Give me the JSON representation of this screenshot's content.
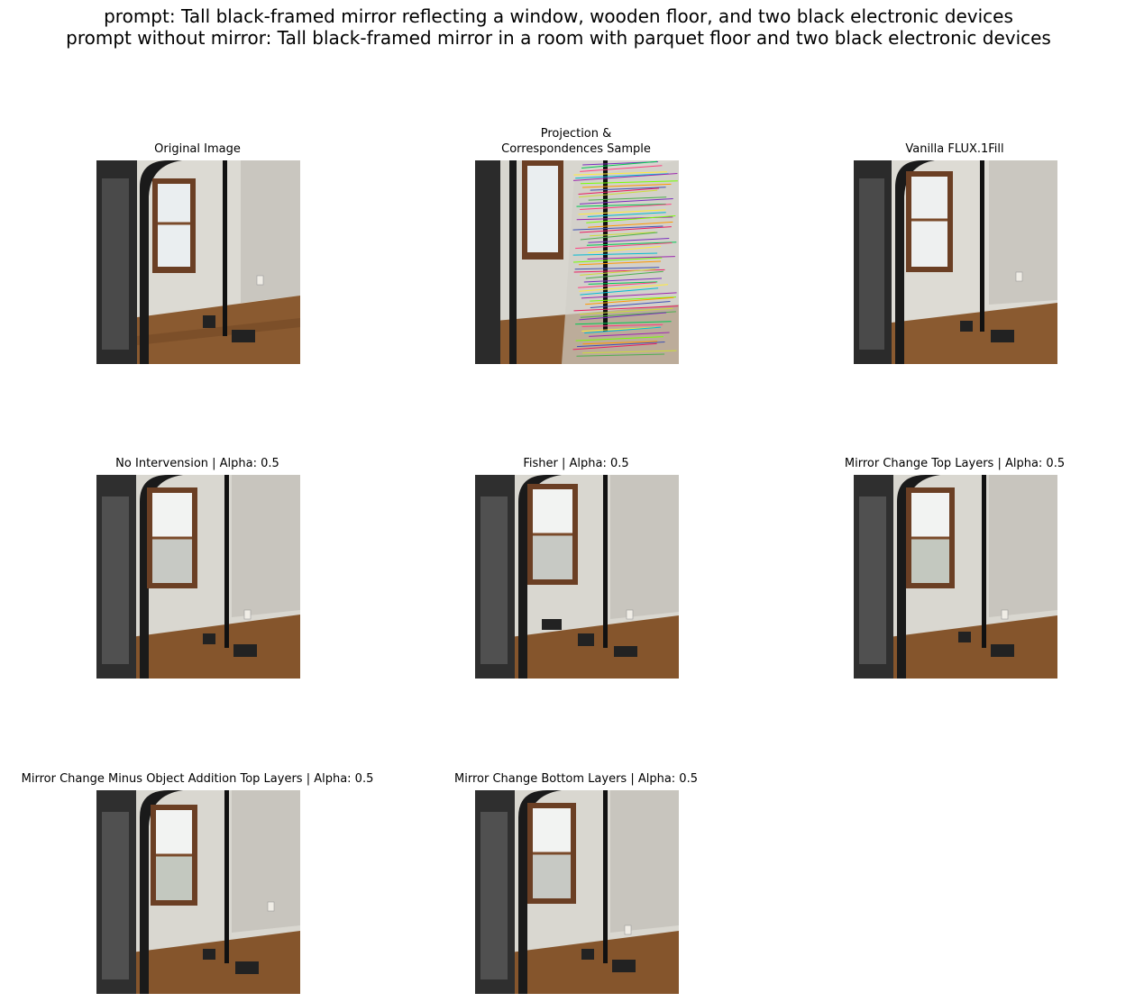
{
  "figure": {
    "title_line1": "prompt: Tall black-framed mirror reflecting a window, wooden floor, and two black electronic devices",
    "title_line2": "prompt without mirror: Tall black-framed mirror in a room with parquet floor and two black electronic devices"
  },
  "panels": [
    {
      "id": "original",
      "title": "Original Image"
    },
    {
      "id": "projection",
      "title_line1": "Projection &",
      "title_line2": "Correspondences Sample"
    },
    {
      "id": "vanilla",
      "title": "Vanilla FLUX.1Fill"
    },
    {
      "id": "no-intervention",
      "title": "No Intervension | Alpha: 0.5"
    },
    {
      "id": "fisher",
      "title": "Fisher | Alpha: 0.5"
    },
    {
      "id": "mirror-top",
      "title": "Mirror Change Top Layers | Alpha: 0.5"
    },
    {
      "id": "mirror-minus-object-top",
      "title": "Mirror Change Minus Object Addition Top Layers | Alpha: 0.5"
    },
    {
      "id": "mirror-bottom",
      "title": "Mirror Change Bottom Layers | Alpha: 0.5"
    }
  ]
}
